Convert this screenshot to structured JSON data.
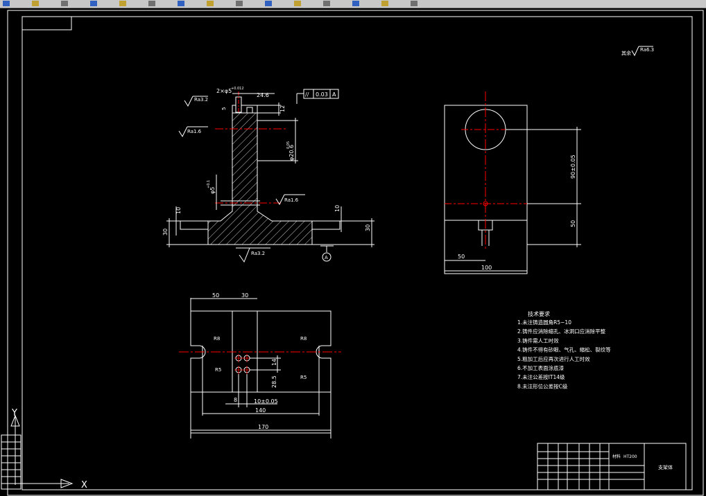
{
  "colors": {
    "background": "#000000",
    "line": "#ffffff",
    "centerline": "#ff0000",
    "toolbar": "#c8c8c8"
  },
  "toolbar_icons": [
    "open-icon",
    "save-icon",
    "print-icon",
    "cut-icon",
    "copy-icon",
    "paste-icon",
    "undo-icon",
    "redo-icon",
    "pan-icon",
    "zoom-icon",
    "zoom-window-icon",
    "properties-icon",
    "layer-icon",
    "grid-icon",
    "help-icon"
  ],
  "drawing": {
    "global_roughness": "Ra6.3",
    "global_roughness_prefix": "其余",
    "front_view": {
      "dim_slot": "2×φ5",
      "dim_slot_tol": "+0.012",
      "dim_top_width": "24.6",
      "dim_top_height": "12",
      "dim_left_small": "5",
      "dim_shaft_dia": "φ20.6",
      "dim_shaft_tol": "0.05",
      "dim_hole_dia": "φ5",
      "dim_hole_tol": "+0.1",
      "dim_left_10": "10",
      "dim_right_10": "10",
      "dim_left_30": "30",
      "dim_right_30": "30",
      "rough_top": "Ra3.2",
      "rough_mid": "Ra1.6",
      "rough_hole": "Ra1.6",
      "rough_bottom": "Ra3.2",
      "tol_symbol": "//",
      "tol_value": "0.03",
      "tol_datum": "A",
      "datum_label": "A"
    },
    "side_view": {
      "dim_90": "90±0.05",
      "dim_50_v": "50",
      "dim_50_h": "50",
      "dim_100": "100"
    },
    "top_view": {
      "dim_50": "50",
      "dim_30": "30",
      "r_left_top": "R8",
      "r_left_bot": "R5",
      "r_right_top": "R8",
      "r_right_bot": "R5",
      "dim_14": "14",
      "dim_28_5": "28.5",
      "dim_8": "8",
      "dim_10": "10±0.05",
      "dim_140": "140",
      "dim_170": "170"
    },
    "notes": {
      "title": "技术要求",
      "items": [
        "1.未注铸造圆角R5−10",
        "2.铸件应消除缩孔、冰洞口应消除平整",
        "3.铸件需人工时效",
        "4.铸件不得有砂眼、气孔、缩松、裂纹等",
        "5.粗加工后应再次进行人工时效",
        "6.不加工表面涂底漆",
        "7.未注公差按IT14级",
        "8.未注形位公差按C级"
      ]
    },
    "title_block": {
      "material": "HT200",
      "material_prefix": "材料",
      "part_name": "支架体"
    },
    "ucs": {
      "x_label": "X",
      "y_label": "Y"
    }
  }
}
